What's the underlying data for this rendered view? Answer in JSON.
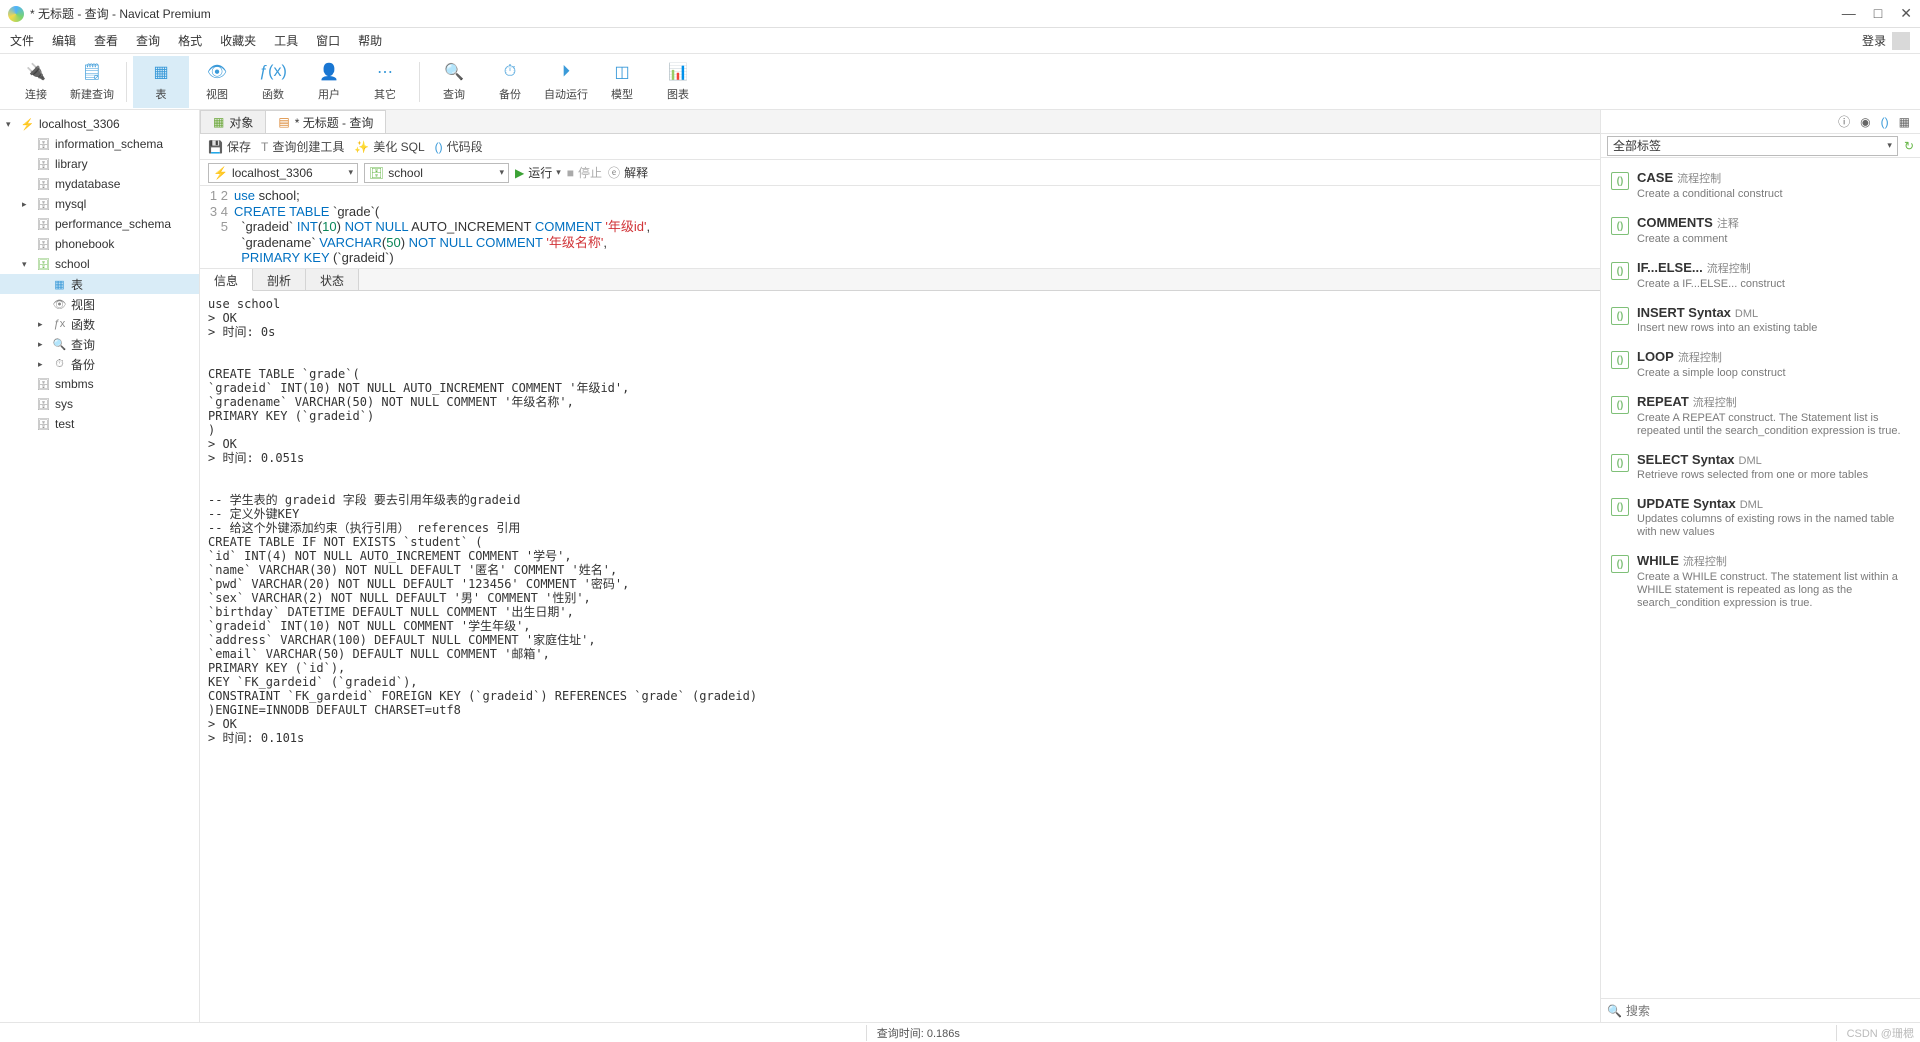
{
  "title": "* 无标题 - 查询 - Navicat Premium",
  "win": {
    "min": "—",
    "max": "□",
    "close": "✕"
  },
  "menu": [
    "文件",
    "编辑",
    "查看",
    "查询",
    "格式",
    "收藏夹",
    "工具",
    "窗口",
    "帮助"
  ],
  "loginLabel": "登录",
  "toolbar": [
    {
      "id": "connect",
      "label": "连接"
    },
    {
      "id": "new-query",
      "label": "新建查询"
    },
    {
      "id": "table",
      "label": "表"
    },
    {
      "id": "view",
      "label": "视图"
    },
    {
      "id": "func",
      "label": "函数"
    },
    {
      "id": "user",
      "label": "用户"
    },
    {
      "id": "other",
      "label": "其它"
    },
    {
      "id": "query",
      "label": "查询"
    },
    {
      "id": "backup",
      "label": "备份"
    },
    {
      "id": "autorun",
      "label": "自动运行"
    },
    {
      "id": "model",
      "label": "模型"
    },
    {
      "id": "chart",
      "label": "图表"
    }
  ],
  "nav": {
    "root": "localhost_3306",
    "dbs": [
      "information_schema",
      "library",
      "mydatabase",
      "mysql",
      "performance_schema",
      "phonebook"
    ],
    "openDb": "school",
    "openChildren": [
      {
        "id": "table",
        "label": "表"
      },
      {
        "id": "view",
        "label": "视图"
      },
      {
        "id": "func",
        "label": "函数"
      },
      {
        "id": "query",
        "label": "查询"
      },
      {
        "id": "backup",
        "label": "备份"
      }
    ],
    "tail": [
      "smbms",
      "sys",
      "test"
    ]
  },
  "tabs": {
    "t1": "对象",
    "t2": "* 无标题 - 查询"
  },
  "qbar": {
    "save": "保存",
    "tool": "查询创建工具",
    "beautify": "美化 SQL",
    "code": "代码段"
  },
  "selrow": {
    "conn": "localhost_3306",
    "db": "school",
    "run": "运行",
    "stop": "停止",
    "explain": "解释"
  },
  "codeLines": [
    "1",
    "2",
    "3",
    "4",
    "5"
  ],
  "codeHtml": "<span class='kw'>use</span> school;\n<span class='kw'>CREATE TABLE</span> `grade`(\n  `gradeid` <span class='ty'>INT</span>(<span class='num'>10</span>) <span class='kw'>NOT NULL</span> AUTO_INCREMENT <span class='kw'>COMMENT</span> <span class='str'>'年级id'</span>,\n  `gradename` <span class='ty'>VARCHAR</span>(<span class='num'>50</span>) <span class='kw'>NOT NULL</span> <span class='kw'>COMMENT</span> <span class='str'>'年级名称'</span>,\n  <span class='kw'>PRIMARY KEY</span> (`gradeid`)",
  "resultTabs": [
    "信息",
    "剖析",
    "状态"
  ],
  "output": "use school\n> OK\n> 时间: 0s\n\n\nCREATE TABLE `grade`(\n`gradeid` INT(10) NOT NULL AUTO_INCREMENT COMMENT '年级id',\n`gradename` VARCHAR(50) NOT NULL COMMENT '年级名称',\nPRIMARY KEY (`gradeid`)\n)\n> OK\n> 时间: 0.051s\n\n\n-- 学生表的 gradeid 字段 要去引用年级表的gradeid\n-- 定义外键KEY\n-- 给这个外键添加约束（执行引用） references 引用\nCREATE TABLE IF NOT EXISTS `student` (\n`id` INT(4) NOT NULL AUTO_INCREMENT COMMENT '学号',\n`name` VARCHAR(30) NOT NULL DEFAULT '匿名' COMMENT '姓名',\n`pwd` VARCHAR(20) NOT NULL DEFAULT '123456' COMMENT '密码',\n`sex` VARCHAR(2) NOT NULL DEFAULT '男' COMMENT '性别',\n`birthday` DATETIME DEFAULT NULL COMMENT '出生日期',\n`gradeid` INT(10) NOT NULL COMMENT '学生年级',\n`address` VARCHAR(100) DEFAULT NULL COMMENT '家庭住址',\n`email` VARCHAR(50) DEFAULT NULL COMMENT '邮箱',\nPRIMARY KEY (`id`),\nKEY `FK_gardeid` (`gradeid`),\nCONSTRAINT `FK_gardeid` FOREIGN KEY (`gradeid`) REFERENCES `grade` (gradeid)\n)ENGINE=INNODB DEFAULT CHARSET=utf8\n> OK\n> 时间: 0.101s",
  "right": {
    "tagLabel": "全部标签",
    "snips": [
      {
        "t": "CASE",
        "g": "流程控制",
        "d": "Create a conditional construct"
      },
      {
        "t": "COMMENTS",
        "g": "注释",
        "d": "Create a comment"
      },
      {
        "t": "IF...ELSE...",
        "g": "流程控制",
        "d": "Create a IF...ELSE... construct"
      },
      {
        "t": "INSERT Syntax",
        "g": "DML",
        "d": "Insert new rows into an existing table"
      },
      {
        "t": "LOOP",
        "g": "流程控制",
        "d": "Create a simple loop construct"
      },
      {
        "t": "REPEAT",
        "g": "流程控制",
        "d": "Create A REPEAT construct. The Statement list is repeated until the search_condition expression is true."
      },
      {
        "t": "SELECT Syntax",
        "g": "DML",
        "d": "Retrieve rows selected from one or more tables"
      },
      {
        "t": "UPDATE Syntax",
        "g": "DML",
        "d": "Updates columns of existing rows in the named table with new values"
      },
      {
        "t": "WHILE",
        "g": "流程控制",
        "d": "Create a WHILE construct. The statement list within a WHILE statement is repeated as long as the search_condition expression is true."
      }
    ],
    "searchPlaceholder": "搜索"
  },
  "status": {
    "time": "查询时间: 0.186s",
    "wm": "CSDN @珊楒"
  }
}
